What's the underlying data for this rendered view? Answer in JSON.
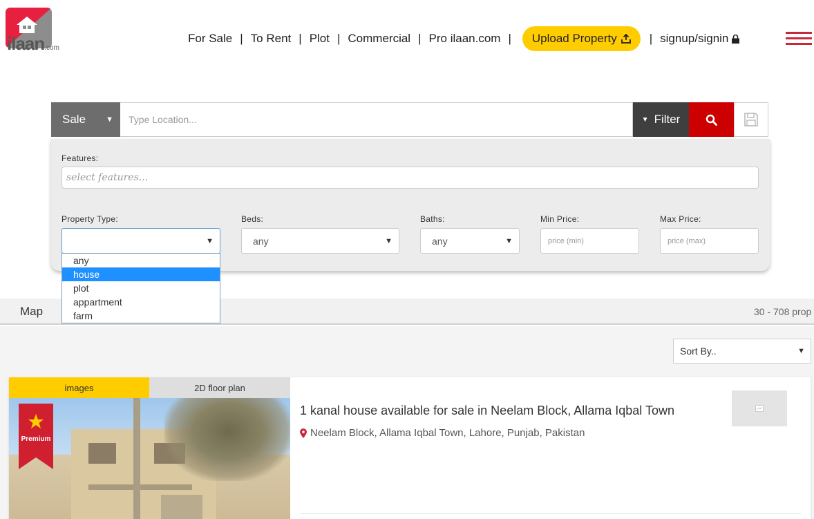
{
  "brand": {
    "logo_text": "ilaan",
    "logo_suffix": ".com"
  },
  "nav": {
    "items": [
      "For Sale",
      "To Rent",
      "Plot",
      "Commercial",
      "Pro ilaan.com"
    ],
    "separator": "|",
    "upload_label": "Upload Property",
    "signin_label": "signup/signin"
  },
  "search": {
    "purpose_value": "Sale",
    "location_placeholder": "Type Location...",
    "filter_label": "Filter"
  },
  "filters": {
    "features_label": "Features:",
    "features_placeholder": "select features...",
    "property_type_label": "Property Type:",
    "property_type_value": "",
    "property_type_options": [
      "any",
      "house",
      "plot",
      "appartment",
      "farm"
    ],
    "property_type_highlighted": "house",
    "beds_label": "Beds:",
    "beds_value": "any",
    "baths_label": "Baths:",
    "baths_value": "any",
    "min_price_label": "Min Price:",
    "min_price_placeholder": "price (min)",
    "max_price_label": "Max Price:",
    "max_price_placeholder": "price (max)"
  },
  "results": {
    "map_label": "Map",
    "count_text": "30 - 708 prop",
    "sort_value": "Sort By.."
  },
  "listing": {
    "tab_images": "images",
    "tab_floor_plan": "2D floor plan",
    "badge": "Premium",
    "title": "1 kanal house available for sale in Neelam Block, Allama Iqbal Town",
    "location": "Neelam Block, Allama Iqbal Town, Lahore, Punjab, Pakistan"
  },
  "colors": {
    "brand_red": "#e8203f",
    "accent_yellow": "#ffcc00",
    "search_red": "#cc0000",
    "highlight_blue": "#1e90ff",
    "menu_red": "#c8283c"
  }
}
